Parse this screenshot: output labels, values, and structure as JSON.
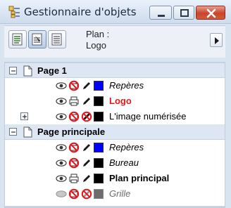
{
  "window": {
    "title": "Gestionnaire d'objets"
  },
  "toolbar": {
    "plan_label": "Plan :",
    "plan_value": "Logo"
  },
  "tree": {
    "pages": [
      {
        "name": "Page 1",
        "layers": [
          {
            "name": "Repères",
            "style": "italic",
            "color": "#0000ff",
            "visible": true,
            "printable": false,
            "editable": true,
            "expandable": false
          },
          {
            "name": "Logo",
            "style": "active",
            "color": "#000000",
            "visible": true,
            "printable": true,
            "editable": true,
            "expandable": false
          },
          {
            "name": "L'image numérisée",
            "style": "normal",
            "color": "#000000",
            "visible": true,
            "printable": false,
            "editable": false,
            "expandable": true
          }
        ]
      },
      {
        "name": "Page principale",
        "layers": [
          {
            "name": "Repères",
            "style": "italic",
            "color": "#0000ff",
            "visible": true,
            "printable": false,
            "editable": true,
            "expandable": false
          },
          {
            "name": "Bureau",
            "style": "italic",
            "color": "#000000",
            "visible": true,
            "printable": false,
            "editable": true,
            "expandable": false
          },
          {
            "name": "Plan principal",
            "style": "bold",
            "color": "#000000",
            "visible": true,
            "printable": true,
            "editable": true,
            "expandable": false
          },
          {
            "name": "Grille",
            "style": "grey",
            "color": "#6d6d6d",
            "visible": false,
            "printable": false,
            "editable": false,
            "expandable": false
          }
        ]
      }
    ]
  },
  "colors": {
    "active_layer": "#e3161b",
    "guides_swatch": "#0000ff",
    "page_row_bg": "#dde7f3"
  }
}
